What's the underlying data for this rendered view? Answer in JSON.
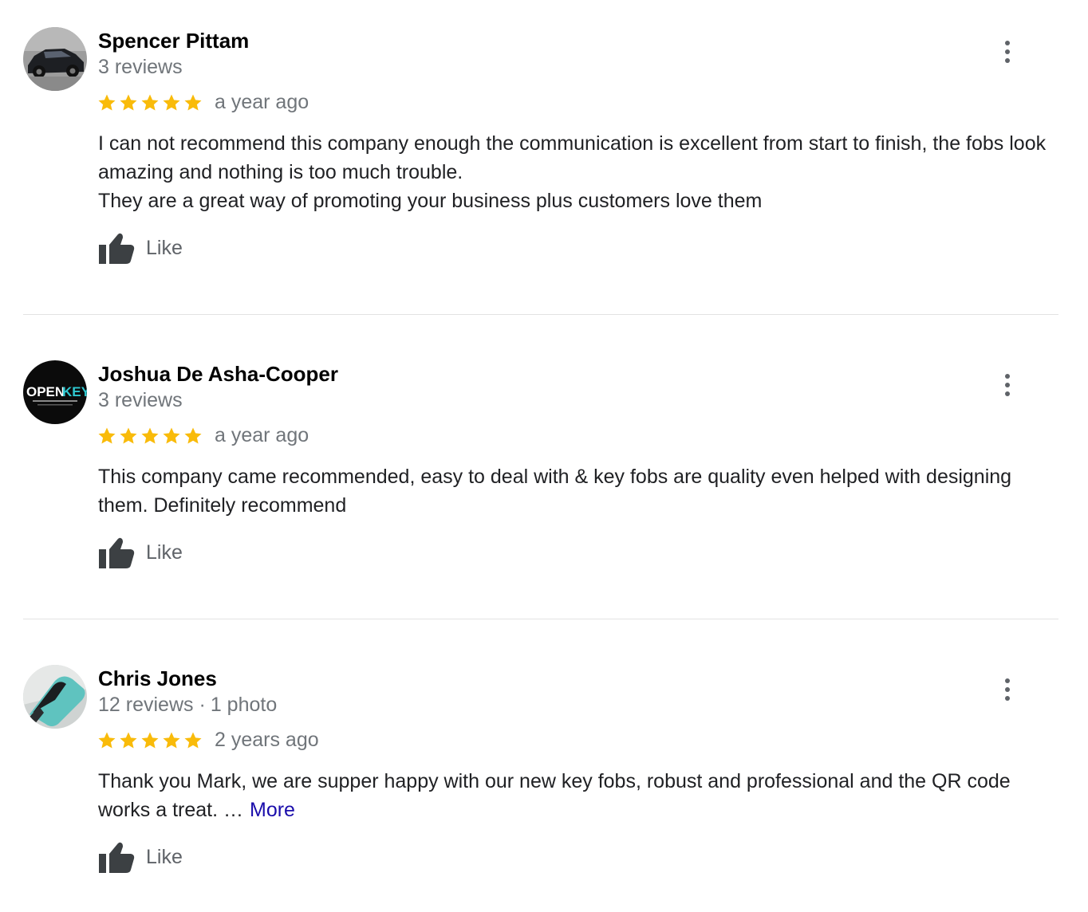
{
  "like_label": "Like",
  "colors": {
    "star": "#f9bb0a",
    "link": "#1a0dab",
    "secondary_text": "#70757a",
    "divider": "#e3e3e3"
  },
  "reviews": [
    {
      "name": "Spencer Pittam",
      "reviews_count": "3 reviews",
      "photos": "",
      "rating": 5,
      "time": "a year ago",
      "paragraphs": [
        "I can not recommend this company enough the communication is excellent from start to finish, the fobs look amazing and nothing is too much trouble.",
        "They are a great way of promoting your business plus customers love them"
      ],
      "more_label": "",
      "avatar_icon": "car-photo-avatar"
    },
    {
      "name": "Joshua De Asha-Cooper",
      "reviews_count": "3 reviews",
      "photos": "",
      "rating": 5,
      "time": "a year ago",
      "paragraphs": [
        "This company came recommended, easy to deal with & key fobs are quality even helped with designing them. Definitely recommend"
      ],
      "more_label": "",
      "avatar_icon": "openkey-logo-avatar",
      "avatar_logo_text": [
        "OPEN",
        "KEY"
      ]
    },
    {
      "name": "Chris Jones",
      "reviews_count": "12 reviews",
      "photos": "1 photo",
      "rating": 5,
      "time": "2 years ago",
      "paragraphs": [
        "Thank you Mark, we are supper happy with our new key fobs, robust and professional and the QR code works a treat. …"
      ],
      "more_label": "More",
      "avatar_icon": "key-fob-photo-avatar"
    }
  ]
}
